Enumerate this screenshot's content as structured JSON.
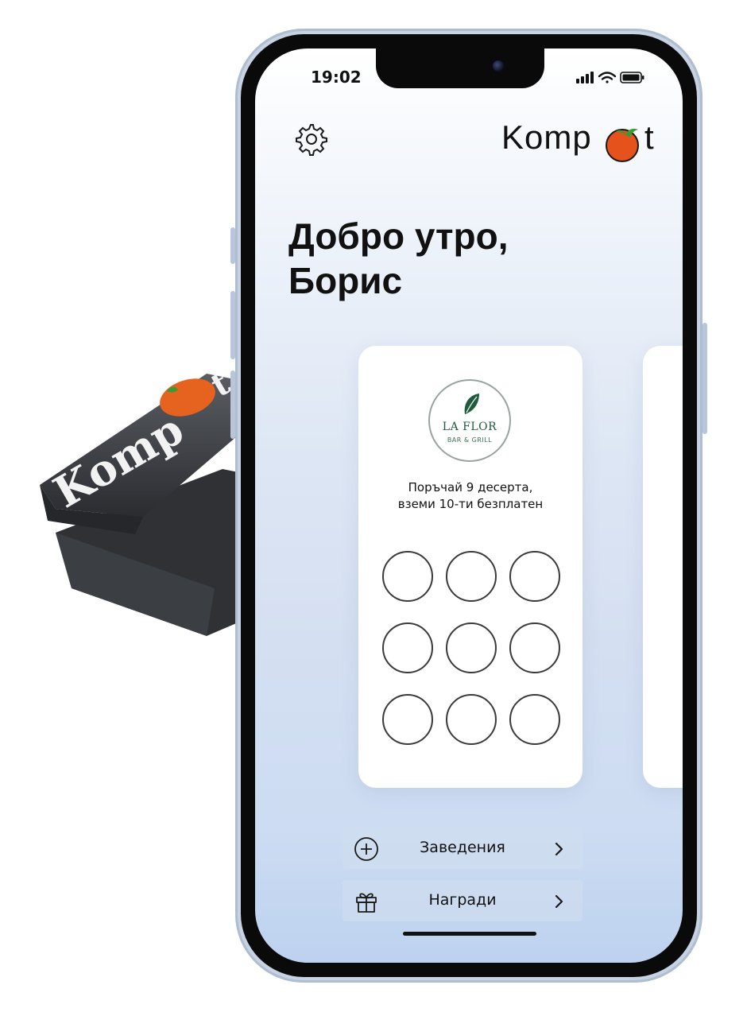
{
  "device": {
    "brand": "Komp",
    "brand_end": "t"
  },
  "status_bar": {
    "time": "19:02"
  },
  "header": {
    "settings_icon": "gear-icon",
    "brand_prefix": "Komp",
    "brand_suffix": "t",
    "brand_logo": "tomato-icon"
  },
  "greeting": {
    "line1": "Добро утро,",
    "line2": "Борис"
  },
  "card": {
    "logo_name": "LA FLOR",
    "logo_sub": "BAR & GRILL",
    "offer_line1": "Поръчай 9 десерта,",
    "offer_line2": "вземи 10-ти безплатен",
    "stamps_total": 9,
    "stamps_filled": 0
  },
  "menu": [
    {
      "label": "Заведения",
      "icon": "plus-circle-icon"
    },
    {
      "label": "Награди",
      "icon": "gift-icon"
    }
  ],
  "colors": {
    "accent": "#e5521c",
    "leaf": "#2f8a3a",
    "logo_green": "#1e5c3c"
  }
}
